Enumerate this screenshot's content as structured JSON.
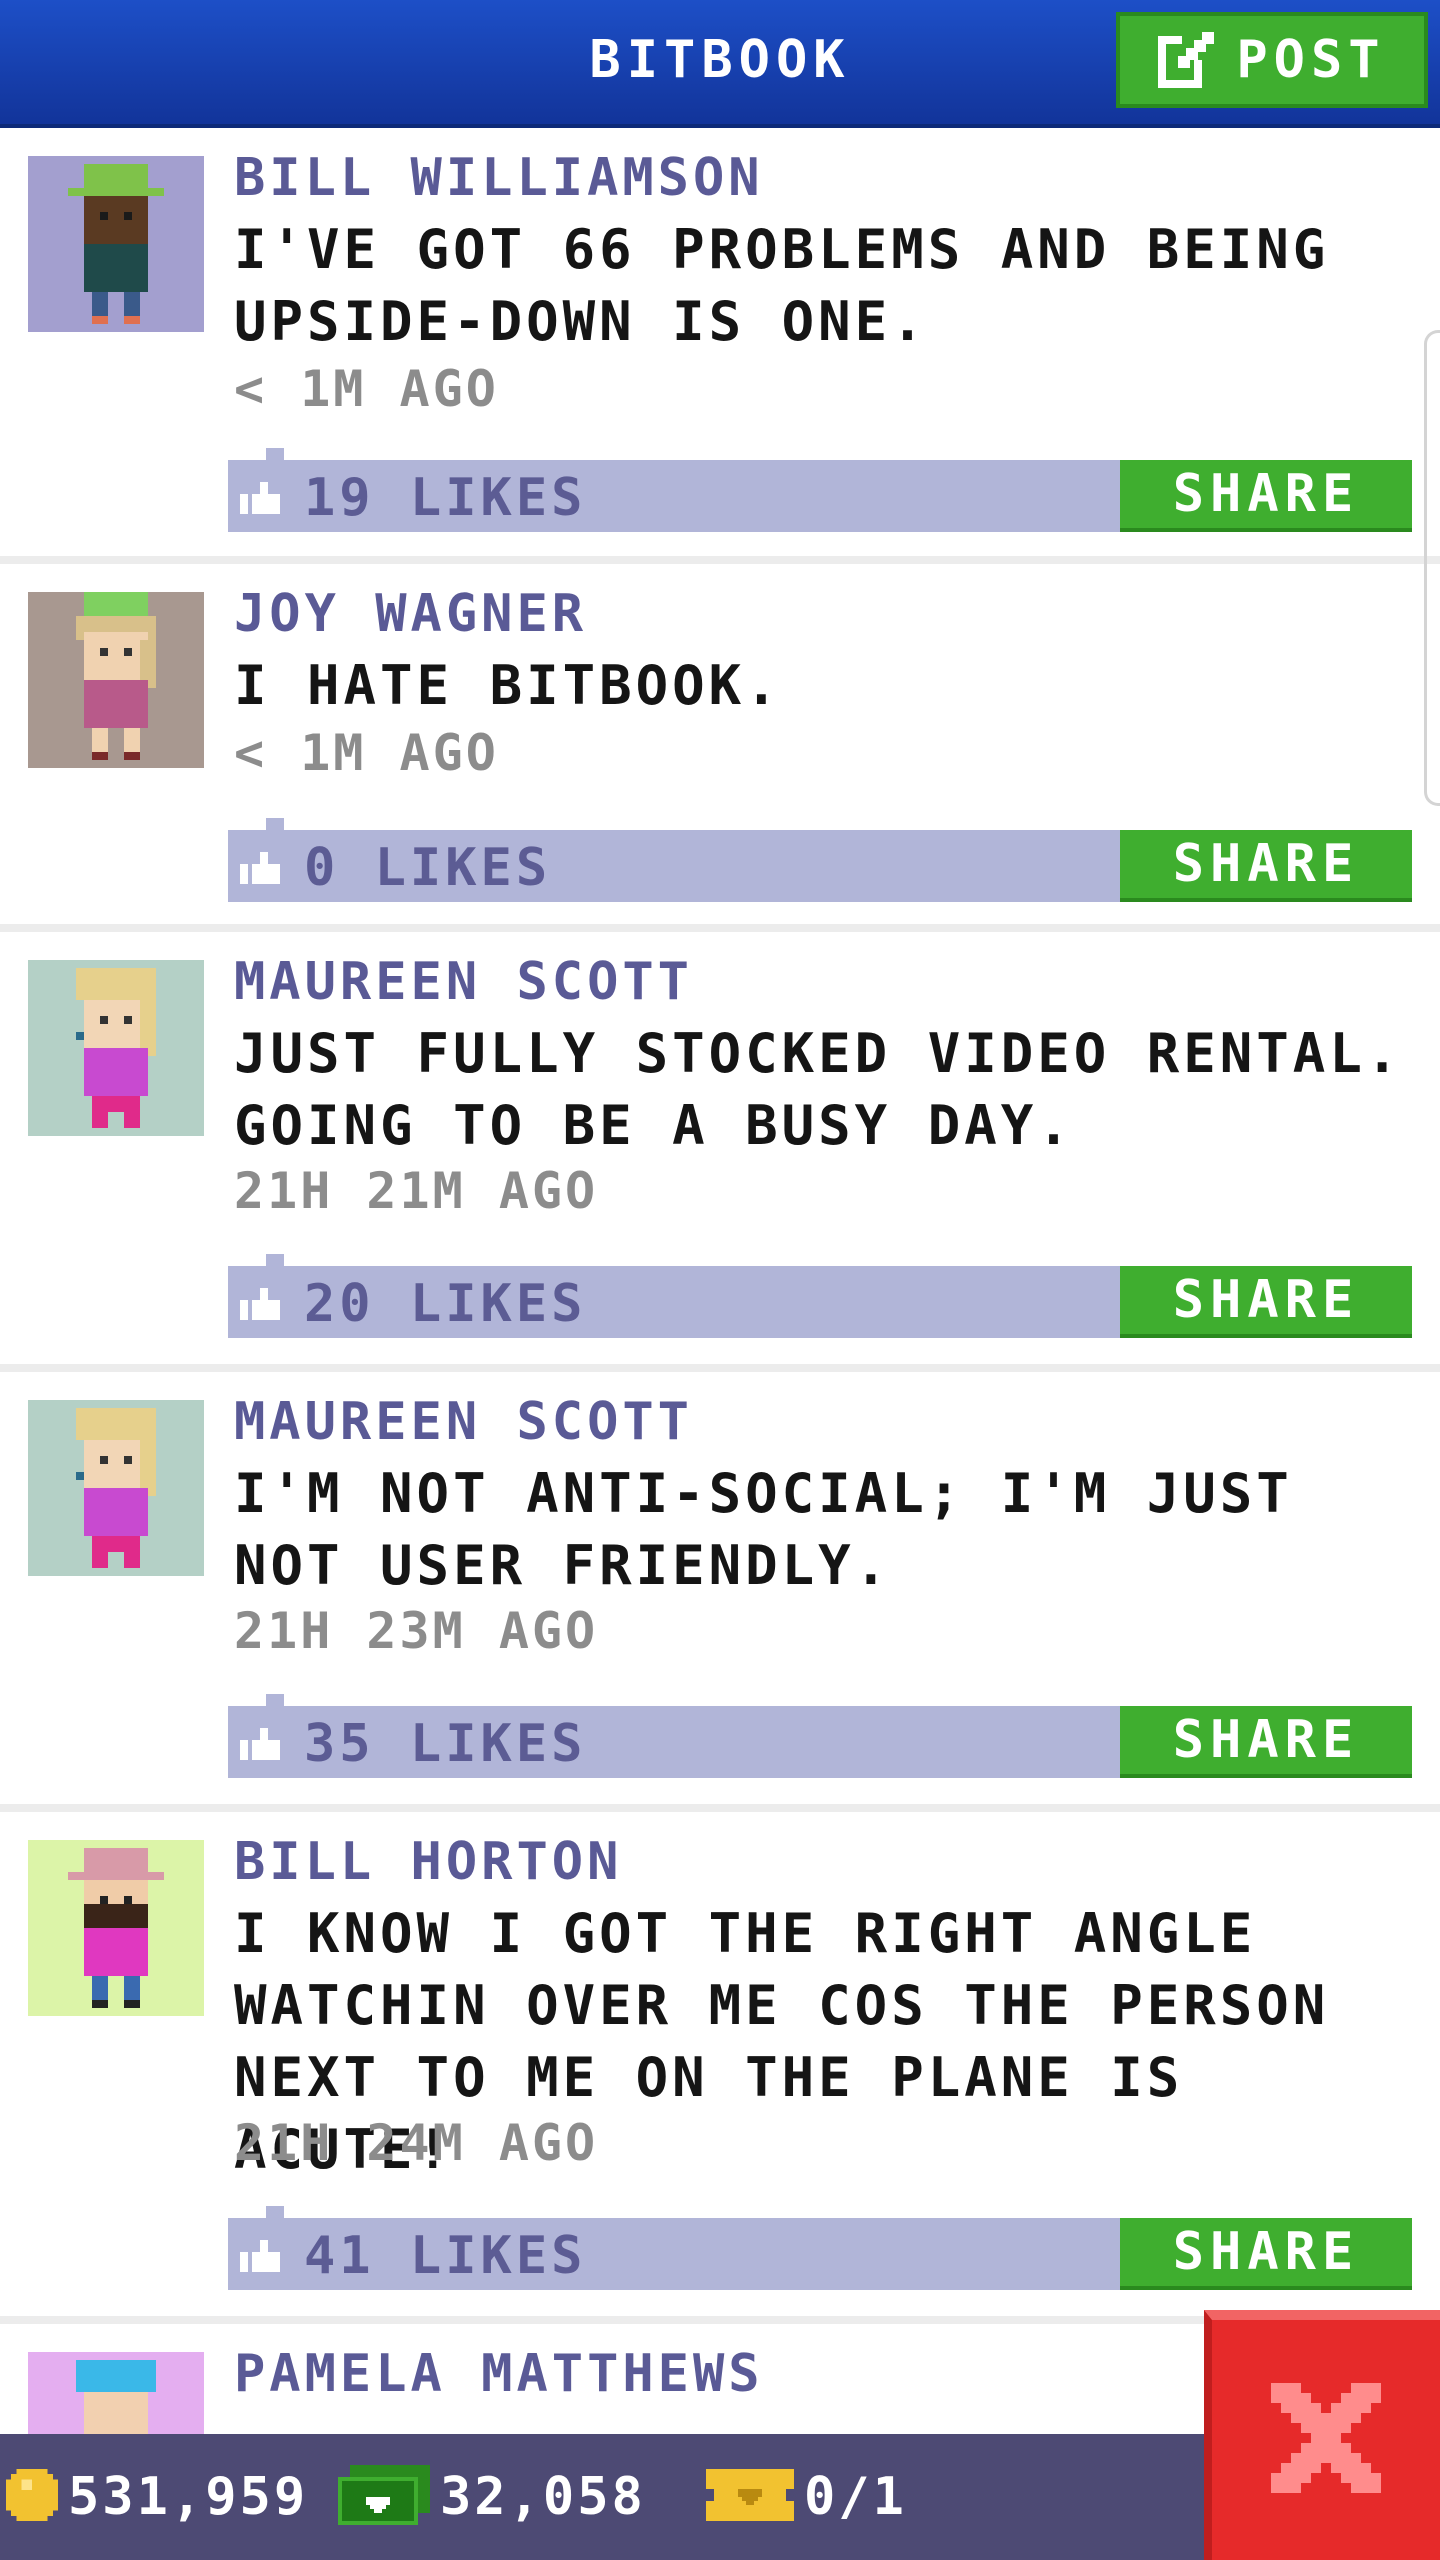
{
  "header": {
    "title": "BITBOOK",
    "post_label": "POST"
  },
  "posts": [
    {
      "author": "BILL WILLIAMSON",
      "message": "I'VE GOT 66 PROBLEMS AND BEING UPSIDE-DOWN IS ONE.",
      "time": "< 1M AGO",
      "likes": "19 LIKES",
      "share": "SHARE"
    },
    {
      "author": "JOY WAGNER",
      "message": "I HATE BITBOOK.",
      "time": "< 1M AGO",
      "likes": "0 LIKES",
      "share": "SHARE"
    },
    {
      "author": "MAUREEN SCOTT",
      "message": "JUST FULLY STOCKED VIDEO RENTAL. GOING TO BE A BUSY DAY.",
      "time": "21H 21M AGO",
      "likes": "20 LIKES",
      "share": "SHARE"
    },
    {
      "author": "MAUREEN SCOTT",
      "message": "I'M NOT ANTI-SOCIAL; I'M JUST NOT USER FRIENDLY.",
      "time": "21H 23M AGO",
      "likes": "35 LIKES",
      "share": "SHARE"
    },
    {
      "author": "BILL HORTON",
      "message": "I KNOW I GOT THE RIGHT ANGLE WATCHIN OVER ME COS THE PERSON NEXT TO ME ON THE PLANE IS ACUTE!",
      "time": "21H 24M AGO",
      "likes": "41 LIKES",
      "share": "SHARE"
    },
    {
      "author": "PAMELA MATTHEWS"
    }
  ],
  "status_bar": {
    "coins": "531,959",
    "bux": "32,058",
    "tickets": "0/1"
  },
  "colors": {
    "header": "#1d4fc7",
    "share_green": "#3fae2f",
    "like_bar": "#b1b5d8",
    "close_red": "#e62a2a",
    "bottom_bar": "#4d4a74"
  },
  "icons": [
    "edit-icon",
    "thumbs-up-icon",
    "coin-icon",
    "bux-icon",
    "ticket-icon",
    "close-icon"
  ]
}
